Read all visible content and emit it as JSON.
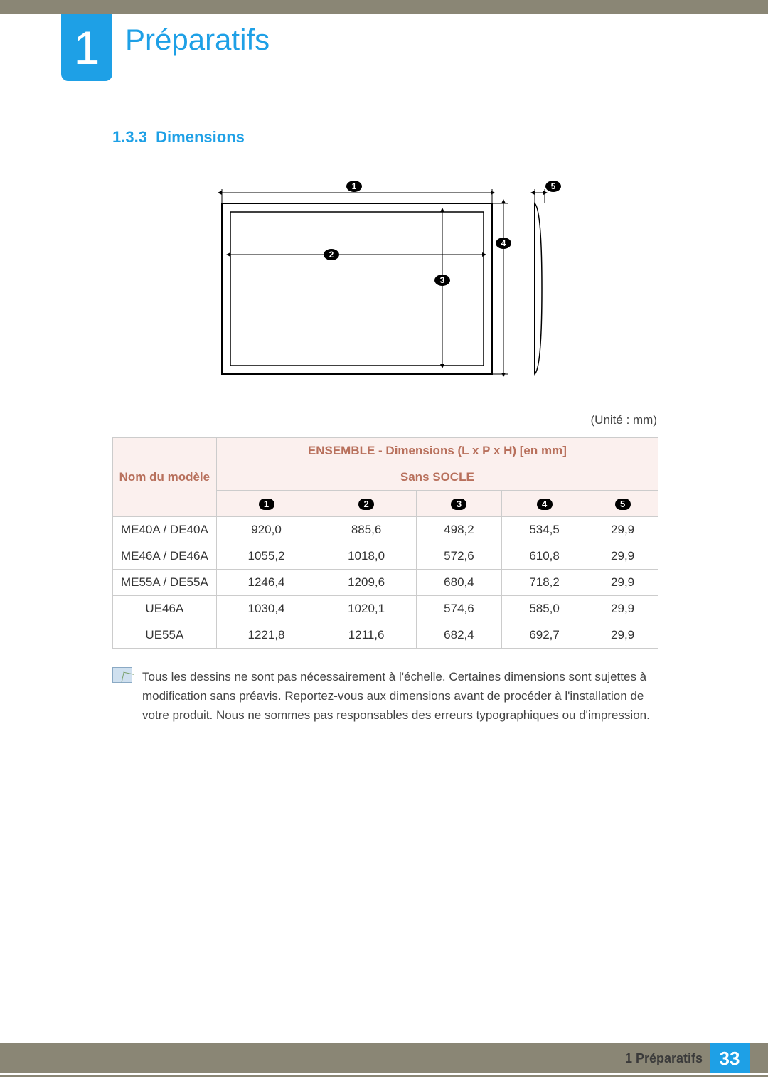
{
  "chapter": {
    "number": "1",
    "title": "Préparatifs"
  },
  "section": {
    "number": "1.3.3",
    "title": "Dimensions"
  },
  "unit_label": "(Unité : mm)",
  "table": {
    "col_model": "Nom du modèle",
    "header_main": "ENSEMBLE - Dimensions (L x P x H) [en mm]",
    "header_sub": "Sans SOCLE",
    "num_cols": [
      "1",
      "2",
      "3",
      "4",
      "5"
    ],
    "rows": [
      {
        "model": "ME40A / DE40A",
        "c1": "920,0",
        "c2": "885,6",
        "c3": "498,2",
        "c4": "534,5",
        "c5": "29,9"
      },
      {
        "model": "ME46A / DE46A",
        "c1": "1055,2",
        "c2": "1018,0",
        "c3": "572,6",
        "c4": "610,8",
        "c5": "29,9"
      },
      {
        "model": "ME55A / DE55A",
        "c1": "1246,4",
        "c2": "1209,6",
        "c3": "680,4",
        "c4": "718,2",
        "c5": "29,9"
      },
      {
        "model": "UE46A",
        "c1": "1030,4",
        "c2": "1020,1",
        "c3": "574,6",
        "c4": "585,0",
        "c5": "29,9"
      },
      {
        "model": "UE55A",
        "c1": "1221,8",
        "c2": "1211,6",
        "c3": "682,4",
        "c4": "692,7",
        "c5": "29,9"
      }
    ]
  },
  "note_text": "Tous les dessins ne sont pas nécessairement à l'échelle. Certaines dimensions sont sujettes à modification sans préavis. Reportez-vous aux dimensions avant de procéder à l'installation de votre produit. Nous ne sommes pas responsables des erreurs typographiques ou d'impression.",
  "footer": {
    "running": "1 Préparatifs",
    "page": "33"
  }
}
